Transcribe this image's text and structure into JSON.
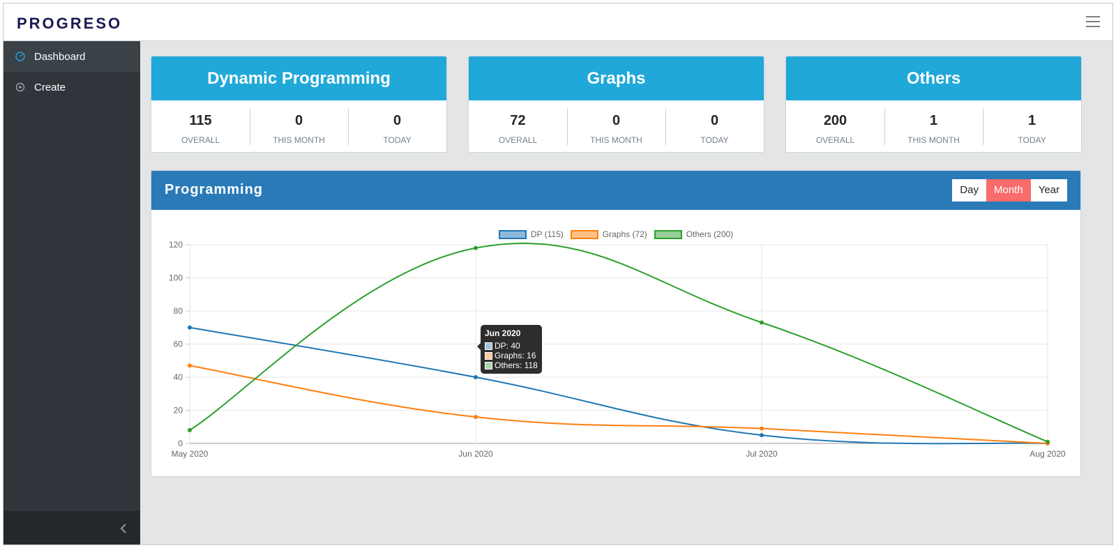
{
  "app": {
    "brand": "PROGRESO"
  },
  "sidebar": {
    "items": [
      {
        "label": "Dashboard",
        "icon": "speedometer-icon",
        "active": true
      },
      {
        "label": "Create",
        "icon": "target-icon",
        "active": false
      }
    ]
  },
  "stats": [
    {
      "title": "Dynamic Programming",
      "overall": "115",
      "month": "0",
      "today": "0"
    },
    {
      "title": "Graphs",
      "overall": "72",
      "month": "0",
      "today": "0"
    },
    {
      "title": "Others",
      "overall": "200",
      "month": "1",
      "today": "1"
    }
  ],
  "stat_labels": {
    "overall": "OVERALL",
    "month": "THIS MONTH",
    "today": "TODAY"
  },
  "chart_panel": {
    "title": "Programming",
    "buttons": [
      "Day",
      "Month",
      "Year"
    ],
    "active_button": "Month"
  },
  "colors": {
    "stat_header": "#20a8d8",
    "chart_header": "#2a7ab8",
    "active_button": "#f86c6b",
    "sidebar": "#2f353a"
  },
  "tooltip": {
    "title": "Jun 2020",
    "rows": [
      "DP: 40",
      "Graphs: 16",
      "Others: 118"
    ]
  },
  "chart_data": {
    "type": "line",
    "x": [
      "May 2020",
      "Jun 2020",
      "Jul 2020",
      "Aug 2020"
    ],
    "ylim": [
      0,
      120
    ],
    "yticks": [
      0,
      20,
      40,
      60,
      80,
      100,
      120
    ],
    "grid": true,
    "legend_placement": "top",
    "series": [
      {
        "name": "DP (115)",
        "values": [
          70,
          40,
          5,
          0
        ],
        "color": "#1f77b4",
        "fill": "#8fb9da"
      },
      {
        "name": "Graphs (72)",
        "values": [
          47,
          16,
          9,
          0
        ],
        "color": "#ff7f0e",
        "fill": "#ffbf86"
      },
      {
        "name": "Others (200)",
        "values": [
          8,
          118,
          73,
          1
        ],
        "color": "#2ca02c",
        "fill": "#95cf95"
      }
    ]
  }
}
